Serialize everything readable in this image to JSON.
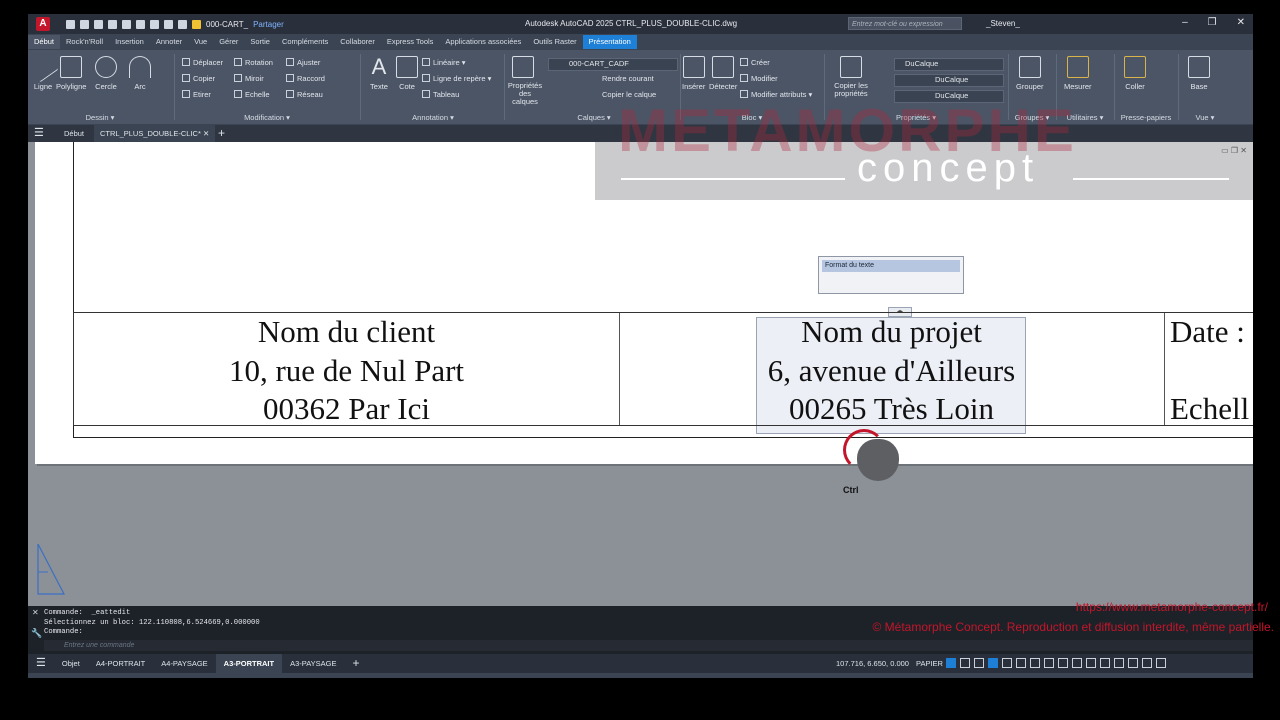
{
  "titlebar": {
    "app_icon": "A",
    "title": "Autodesk AutoCAD 2025   CTRL_PLUS_DOUBLE-CLIC.dwg",
    "layer_combo": "000-CART_",
    "share": "Partager",
    "search_placeholder": "Entrez mot-clé ou expression",
    "user": "_Steven_"
  },
  "ribbon_tabs": [
    "Début",
    "Rock'n'Roll",
    "Insertion",
    "Annoter",
    "Vue",
    "Gérer",
    "Sortie",
    "Compléments",
    "Collaborer",
    "Express Tools",
    "Applications associées",
    "Outils Raster",
    "Présentation"
  ],
  "ribbon": {
    "dessin": {
      "title": "Dessin ▾",
      "tools": [
        "Ligne",
        "Polyligne",
        "Cercle",
        "Arc"
      ]
    },
    "modification": {
      "title": "Modification ▾",
      "rows": [
        [
          "Déplacer",
          "Rotation",
          "Ajuster"
        ],
        [
          "Copier",
          "Miroir",
          "Raccord"
        ],
        [
          "Etirer",
          "Echelle",
          "Réseau"
        ]
      ]
    },
    "annotation": {
      "title": "Annotation ▾",
      "texte": "Texte",
      "cote": "Cote",
      "rows": [
        "Linéaire ▾",
        "Ligne de repère ▾",
        "Tableau"
      ]
    },
    "calques": {
      "title": "Calques ▾",
      "props": "Propriétés des calques",
      "layer": "000-CART_CADF",
      "rows": [
        "Rendre courant",
        "Copier le calque"
      ]
    },
    "bloc": {
      "title": "Bloc ▾",
      "inserer": "Insérer",
      "detecter": "Détecter",
      "rows": [
        "Créer",
        "Modifier",
        "Modifier attributs ▾"
      ]
    },
    "proprietes": {
      "title": "Propriétés ▾",
      "copier": "Copier les propriétés",
      "rows": [
        "DuCalque",
        "DuCalque",
        "DuCalque"
      ]
    },
    "groupes": {
      "title": "Groupes ▾",
      "label": "Grouper"
    },
    "utilitaires": {
      "title": "Utilitaires ▾",
      "label": "Mesurer"
    },
    "presse": {
      "title": "Presse-papiers",
      "label": "Coller"
    },
    "vue": {
      "title": "Vue ▾",
      "label": "Base"
    }
  },
  "file_tabs": {
    "start": "Début",
    "doc": "CTRL_PLUS_DOUBLE-CLIC*"
  },
  "drawing": {
    "client": [
      "Nom du client",
      "10, rue de Nul Part",
      "00362 Par Ici"
    ],
    "projet": [
      "Nom du projet",
      "6, avenue d'Ailleurs",
      "00265 Très Loin"
    ],
    "date": [
      "Date :",
      "",
      "Echell"
    ],
    "format_box": "Format du texte",
    "ctrl": "Ctrl"
  },
  "watermark": {
    "big": "METAMORPHE",
    "concept": "concept"
  },
  "command": {
    "lines": [
      "Commande:  _eattedit",
      "Sélectionnez un bloc: 122.110808,6.524669,0.000000",
      "Commande:"
    ],
    "placeholder": "Entrez une commande"
  },
  "overlay": {
    "url": "https://www.metamorphe-concept.fr/",
    "copyright": "© Métamorphe Concept. Reproduction et diffusion interdite, même partielle."
  },
  "status": {
    "layouts": [
      "Objet",
      "A4-PORTRAIT",
      "A4-PAYSAGE",
      "A3-PORTRAIT",
      "A3-PAYSAGE"
    ],
    "coords": "107.716, 6.650, 0.000",
    "space": "PAPIER"
  }
}
